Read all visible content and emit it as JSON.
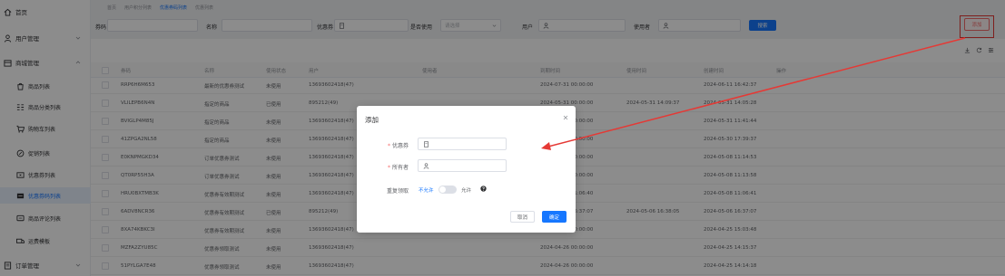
{
  "sidebar": {
    "items": [
      {
        "label": "首页",
        "icon": "home-icon"
      },
      {
        "label": "用户管理",
        "icon": "user-icon"
      },
      {
        "label": "商城管理",
        "icon": "shop-icon"
      }
    ],
    "subitems": [
      {
        "label": "商品列表",
        "icon": "goods-icon"
      },
      {
        "label": "商品分类列表",
        "icon": "category-icon"
      },
      {
        "label": "购物车列表",
        "icon": "cart-icon"
      },
      {
        "label": "促销列表",
        "icon": "promotion-icon"
      },
      {
        "label": "优惠券列表",
        "icon": "coupon-icon"
      },
      {
        "label": "优惠券码列表",
        "icon": "coupon-code-icon"
      },
      {
        "label": "商品评论列表",
        "icon": "comment-icon"
      },
      {
        "label": "运费模板",
        "icon": "shipping-icon"
      }
    ],
    "bottom": {
      "label": "订单管理",
      "icon": "order-icon"
    }
  },
  "tabs": [
    "首页",
    "用户积分列表",
    "优惠券码列表",
    "优惠列表"
  ],
  "active_tab": 2,
  "filters": {
    "code_label": "券码",
    "name_label": "名称",
    "coupon_label": "优惠券",
    "used_label": "是否使用",
    "used_placeholder": "请选择",
    "user_label": "用户",
    "consumer_label": "使用者",
    "search_button": "搜索",
    "add_button": "添加"
  },
  "table": {
    "headers": [
      "券码",
      "名称",
      "使用状态",
      "用户",
      "使用者",
      "到期时间",
      "使用时间",
      "创建时间",
      "操作"
    ],
    "rows": [
      [
        "RRP6H6M653",
        "最新的优惠券测试",
        "未使用",
        "13693602418(47)",
        "",
        "2024-07-31 00:00:00",
        "",
        "2024-06-11 16:42:37"
      ],
      [
        "VLILEPB6N4N",
        "指定的商品",
        "已使用",
        "895212(49)",
        "",
        "2024-05-31 00:00:00",
        "2024-05-31 14:09:37",
        "2024-05-31 14:05:28"
      ],
      [
        "BVIGLP4M85J",
        "指定的商品",
        "未使用",
        "13693602418(47)",
        "",
        "2024-05-31 00:00:00",
        "",
        "2024-05-31 11:41:44"
      ],
      [
        "41ZPGA2NL58",
        "指定的商品",
        "未使用",
        "13693602418(47)",
        "",
        "2024-05-31 00:00:00",
        "",
        "2024-05-30 17:39:37"
      ],
      [
        "E0KNPMGKD34",
        "订单优惠券测试",
        "未使用",
        "13693602418(47)",
        "",
        "2024-05-31 00:00:00",
        "",
        "2024-05-08 11:14:53"
      ],
      [
        "QT0RP55H3A",
        "订单优惠券测试",
        "未使用",
        "13693602418(47)",
        "",
        "2024-05-31 00:00:00",
        "",
        "2024-05-08 11:13:58"
      ],
      [
        "HRU0BXTMB3K",
        "优惠券有效期测试",
        "未使用",
        "13693602418(47)",
        "",
        "2024-05-31 11:06:40",
        "",
        "2024-05-08 11:06:41"
      ],
      [
        "6ADV8NCR36",
        "优惠券有效期测试",
        "已使用",
        "895212(49)",
        "",
        "2024-05-31 16:37:07",
        "2024-05-06 16:38:05",
        "2024-05-06 16:37:07"
      ],
      [
        "8XA74KBKC3I",
        "优惠券有效期测试",
        "未使用",
        "13693602418(47)",
        "",
        "2024-05-31 00:00:00",
        "",
        "2024-04-25 15:03:48"
      ],
      [
        "MZFA2ZYU85C",
        "优惠券领取测试",
        "未使用",
        "13693602418(47)",
        "",
        "2024-04-26 00:00:00",
        "",
        "2024-04-25 14:15:37"
      ],
      [
        "51PYLGA7E48",
        "优惠券领取测试",
        "未使用",
        "13693602418(47)",
        "",
        "2024-04-26 00:00:00",
        "",
        "2024-04-25 14:14:18"
      ]
    ]
  },
  "dialog": {
    "title": "添加",
    "coupon_label": "优惠券",
    "owner_label": "所有者",
    "repeat_label": "重复领取",
    "option_off": "不允许",
    "option_on": "允许",
    "cancel_button": "取消",
    "confirm_button": "确定"
  },
  "colors": {
    "primary": "#1677ff",
    "highlight": "#e53935"
  }
}
